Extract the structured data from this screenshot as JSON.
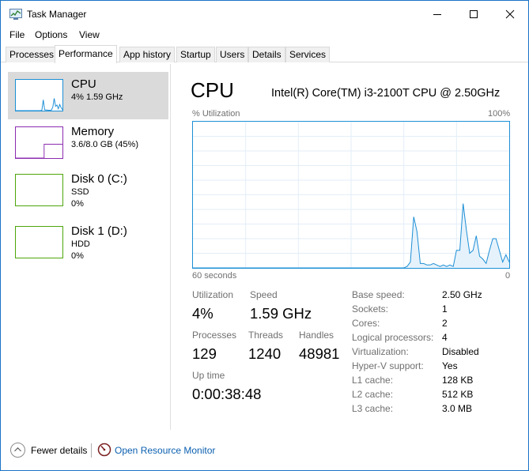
{
  "window": {
    "title": "Task Manager"
  },
  "menu": [
    "File",
    "Options",
    "View"
  ],
  "tabs": [
    "Processes",
    "Performance",
    "App history",
    "Startup",
    "Users",
    "Details",
    "Services"
  ],
  "active_tab": "Performance",
  "resources": [
    {
      "name": "CPU",
      "line1": "4%  1.59 GHz",
      "line2": "",
      "color": "#1c8fd6"
    },
    {
      "name": "Memory",
      "line1": "3.6/8.0 GB (45%)",
      "line2": "",
      "color": "#8b2bb0"
    },
    {
      "name": "Disk 0 (C:)",
      "line1": "SSD",
      "line2": "0%",
      "color": "#4da60c"
    },
    {
      "name": "Disk 1 (D:)",
      "line1": "HDD",
      "line2": "0%",
      "color": "#4da60c"
    }
  ],
  "cpu": {
    "title": "CPU",
    "model": "Intel(R) Core(TM) i3-2100T CPU @ 2.50GHz",
    "utilization_label": "% Utilization",
    "max_label": "100%",
    "time_label": "60 seconds",
    "min_label": "0",
    "stats": {
      "utilization_label": "Utilization",
      "utilization": "4%",
      "speed_label": "Speed",
      "speed": "1.59 GHz",
      "processes_label": "Processes",
      "processes": "129",
      "threads_label": "Threads",
      "threads": "1240",
      "handles_label": "Handles",
      "handles": "48981",
      "uptime_label": "Up time",
      "uptime": "0:00:38:48"
    },
    "specs": [
      {
        "label": "Base speed:",
        "value": "2.50 GHz"
      },
      {
        "label": "Sockets:",
        "value": "1"
      },
      {
        "label": "Cores:",
        "value": "2"
      },
      {
        "label": "Logical processors:",
        "value": "4"
      },
      {
        "label": "Virtualization:",
        "value": "Disabled"
      },
      {
        "label": "Hyper-V support:",
        "value": "Yes"
      },
      {
        "label": "L1 cache:",
        "value": "128 KB"
      },
      {
        "label": "L2 cache:",
        "value": "512 KB"
      },
      {
        "label": "L3 cache:",
        "value": "3.0 MB"
      }
    ],
    "history": [
      0,
      0,
      0,
      0,
      0,
      0,
      0,
      0,
      0,
      0,
      0,
      0,
      0,
      0,
      0,
      0,
      0,
      0,
      0,
      0,
      0,
      0,
      0,
      0,
      0,
      0,
      0,
      0,
      0,
      0,
      0,
      0,
      0,
      0,
      0,
      0,
      0,
      0,
      0,
      0,
      0,
      0,
      0,
      0,
      0,
      0,
      0,
      0,
      0,
      0,
      0,
      0,
      0,
      0,
      0,
      0,
      0,
      0,
      0,
      0,
      0,
      0,
      0,
      0,
      0,
      1,
      4,
      35,
      25,
      3,
      3,
      2,
      2,
      3,
      2,
      1,
      2,
      1,
      2,
      1,
      12,
      12,
      44,
      26,
      10,
      12,
      22,
      8,
      6,
      3,
      12,
      20,
      20,
      12,
      4,
      9,
      4
    ]
  },
  "memory_history_pct": 45,
  "cpu_thumb_history": [
    0,
    0,
    0,
    0,
    0,
    0,
    0,
    0,
    0,
    0,
    0,
    0,
    0,
    0,
    0,
    0,
    0,
    0,
    0,
    2,
    35,
    3,
    2,
    2,
    1,
    1,
    2,
    12,
    40,
    14,
    18,
    6,
    20,
    10,
    3
  ],
  "footer": {
    "fewer_details": "Fewer details",
    "resource_monitor": "Open Resource Monitor"
  }
}
